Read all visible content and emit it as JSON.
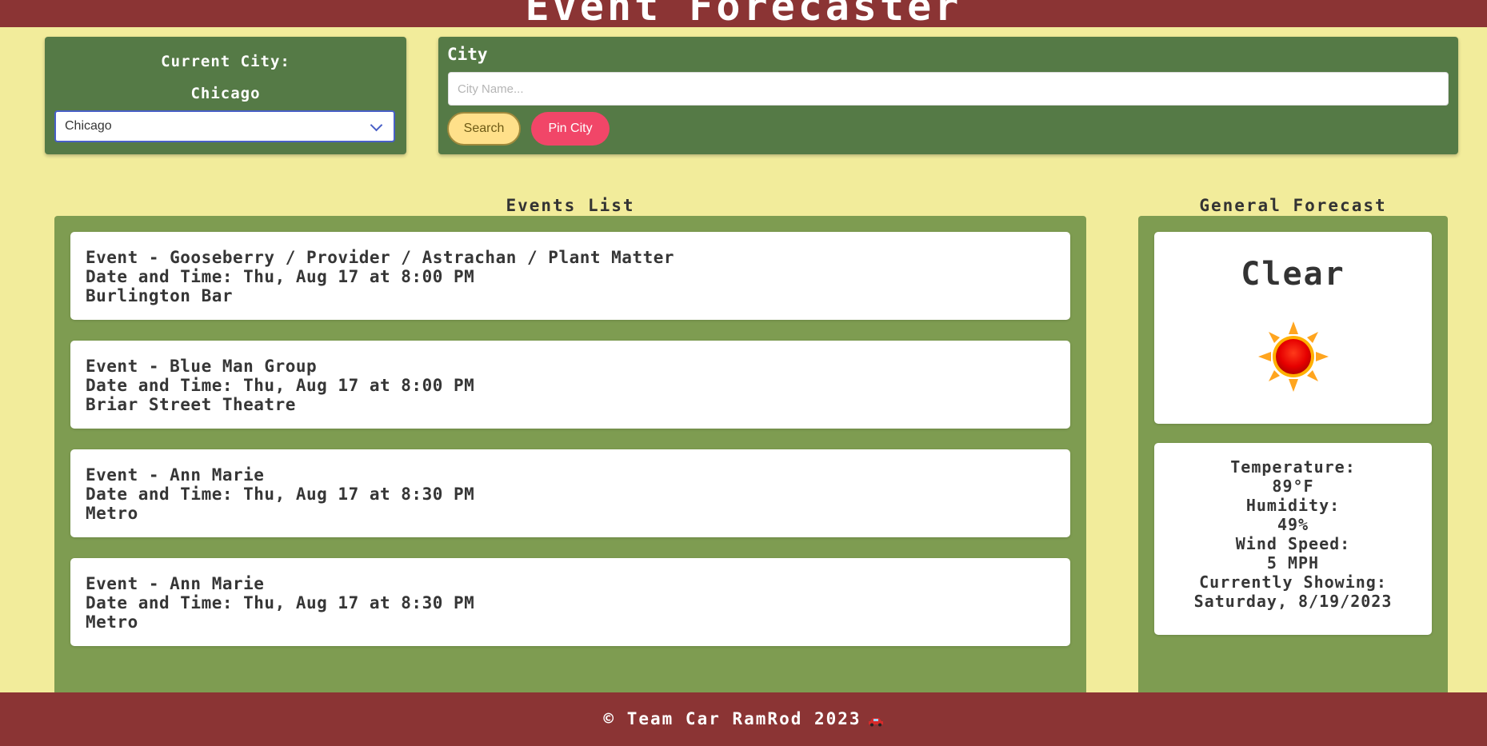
{
  "header": {
    "title": "Event Forecaster"
  },
  "current_city": {
    "label": "Current City:",
    "name": "Chicago",
    "select_value": "Chicago"
  },
  "search": {
    "label": "City",
    "placeholder": "City Name...",
    "search_label": "Search",
    "pin_label": "Pin City"
  },
  "events": {
    "heading": "Events List",
    "items": [
      {
        "title": "Event - Gooseberry / Provider / Astrachan / Plant Matter",
        "datetime": "Date and Time: Thu, Aug 17 at 8:00 PM",
        "venue": "Burlington Bar"
      },
      {
        "title": "Event - Blue Man Group",
        "datetime": "Date and Time: Thu, Aug 17 at 8:00 PM",
        "venue": "Briar Street Theatre"
      },
      {
        "title": "Event - Ann Marie",
        "datetime": "Date and Time: Thu, Aug 17 at 8:30 PM",
        "venue": "Metro"
      },
      {
        "title": "Event - Ann Marie",
        "datetime": "Date and Time: Thu, Aug 17 at 8:30 PM",
        "venue": "Metro"
      }
    ]
  },
  "forecast": {
    "heading": "General Forecast",
    "condition": "Clear",
    "icon": "sun-icon",
    "temperature_label": "Temperature:",
    "temperature_value": "89°F",
    "humidity_label": "Humidity:",
    "humidity_value": "49%",
    "wind_label": "Wind Speed:",
    "wind_value": "5 MPH",
    "showing_label": "Currently Showing:",
    "showing_value": "Saturday, 8/19/2023"
  },
  "footer": {
    "text": "© Team Car RamRod 2023",
    "icon": "car-icon"
  },
  "colors": {
    "header_bg": "#8b3434",
    "page_bg": "#f2ec9b",
    "panel_bg": "#557a46",
    "container_bg": "#7e9c51",
    "search_button": "#ffe08a",
    "pin_button": "#f14668"
  }
}
